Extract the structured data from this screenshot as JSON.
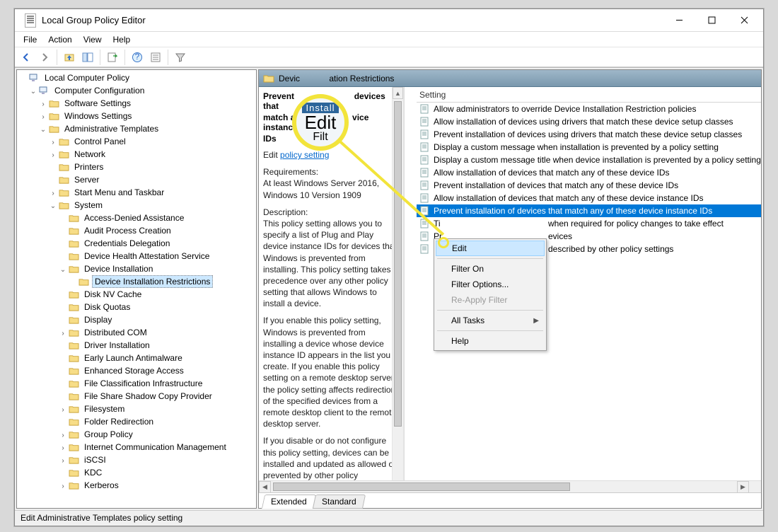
{
  "window": {
    "title": "Local Group Policy Editor"
  },
  "menu": [
    "File",
    "Action",
    "View",
    "Help"
  ],
  "tree": {
    "root": "Local Computer Policy",
    "l1": "Computer Configuration",
    "l2a": "Software Settings",
    "l2b": "Windows Settings",
    "l2c": "Administrative Templates",
    "l3": [
      "Control Panel",
      "Network",
      "Printers",
      "Server",
      "Start Menu and Taskbar"
    ],
    "l3sys": "System",
    "sys_children_before": [
      "Access-Denied Assistance",
      "Audit Process Creation",
      "Credentials Delegation",
      "Device Health Attestation Service"
    ],
    "device_install": "Device Installation",
    "device_install_child": "Device Installation Restrictions",
    "sys_children_after": [
      "Disk NV Cache",
      "Disk Quotas",
      "Display",
      "Distributed COM",
      "Driver Installation",
      "Early Launch Antimalware",
      "Enhanced Storage Access",
      "File Classification Infrastructure",
      "File Share Shadow Copy Provider",
      "Filesystem",
      "Folder Redirection",
      "Group Policy",
      "Internet Communication Management",
      "iSCSI",
      "KDC",
      "Kerberos"
    ]
  },
  "right": {
    "header": "Device Installation Restrictions",
    "desc_title_l1": "Prevent installation of devices that",
    "desc_title_l2": "match any of these device instance",
    "desc_title_l3": "IDs",
    "edit_prefix": "Edit ",
    "edit_link": "policy setting",
    "req_h": "Requirements:",
    "req_body": "At least Windows Server 2016, Windows 10 Version 1909",
    "desc_h": "Description:",
    "desc_p1": "This policy setting allows you to specify a list of Plug and Play device instance IDs for devices that Windows is prevented from installing. This policy setting takes precedence over any other policy setting that allows Windows to install a device.",
    "desc_p2": "If you enable this policy setting, Windows is prevented from installing a device whose device instance ID appears in the list you create. If you enable this policy setting on a remote desktop server, the policy setting affects redirection of the specified devices from a remote desktop client to the remote desktop server.",
    "desc_p3": "If you disable or do not configure this policy setting, devices can be installed and updated as allowed or prevented by other policy",
    "list_header": "Setting",
    "settings": [
      "Allow administrators to override Device Installation Restriction policies",
      "Allow installation of devices using drivers that match these device setup classes",
      "Prevent installation of devices using drivers that match these device setup classes",
      "Display a custom message when installation is prevented by a policy setting",
      "Display a custom message title when device installation is prevented by a policy setting",
      "Allow installation of devices that match any of these device IDs",
      "Prevent installation of devices that match any of these device IDs",
      "Allow installation of devices that match any of these device instance IDs",
      "Prevent installation of devices that match any of these device instance IDs",
      "Time (in seconds) to force reboot when required for policy changes to take effect",
      "Prevent installation of removable devices",
      "Prevent installation of devices not described by other policy settings"
    ],
    "settings_partial_a": "Ti",
    "settings_partial_b": "Pr",
    "settings_tail_9": "when required for policy changes to take effect",
    "settings_tail_10": "evices",
    "settings_tail_11": "described by other policy settings"
  },
  "context_menu": {
    "items": [
      "Edit",
      "Filter On",
      "Filter Options...",
      "Re-Apply Filter",
      "All Tasks",
      "Help"
    ]
  },
  "tabs": {
    "extended": "Extended",
    "standard": "Standard"
  },
  "status": "Edit Administrative Templates policy setting",
  "callout": {
    "big": "Edit",
    "top": "Install",
    "bottom": "Filt"
  }
}
